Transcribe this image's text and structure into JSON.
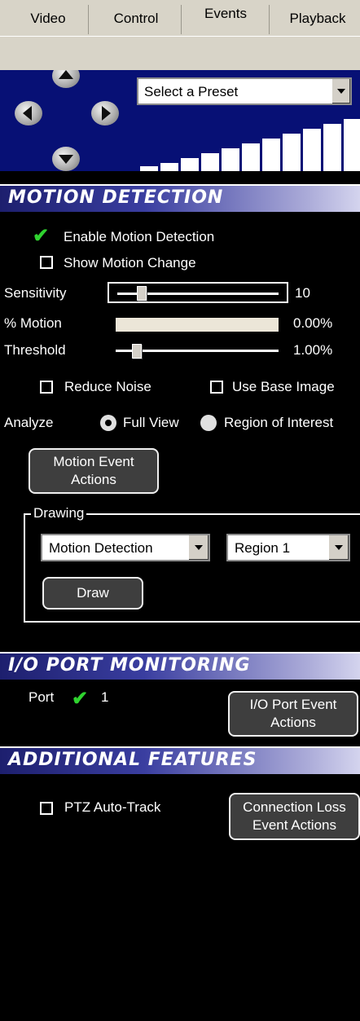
{
  "tabs": [
    {
      "label": "Video"
    },
    {
      "label": "Control"
    },
    {
      "label": "Events",
      "active": true
    },
    {
      "label": "Playback"
    }
  ],
  "ptz": {
    "preset_select": "Select a Preset"
  },
  "motion": {
    "header": "MOTION DETECTION",
    "enable_label": "Enable Motion Detection",
    "enable_checked": true,
    "show_change_label": "Show Motion Change",
    "show_change_checked": false,
    "sensitivity_label": "Sensitivity",
    "sensitivity_value": "10",
    "percent_motion_label": "% Motion",
    "percent_motion_value": "0.00%",
    "threshold_label": "Threshold",
    "threshold_value": "1.00%",
    "reduce_noise_label": "Reduce Noise",
    "base_image_label": "Use Base Image",
    "analyze_label": "Analyze",
    "analyze_options": [
      "Full View",
      "Region of Interest"
    ],
    "analyze_selected": "Full View",
    "event_actions_line1": "Motion Event",
    "event_actions_line2": "Actions",
    "drawing_legend": "Drawing",
    "drawing_mode": "Motion Detection",
    "drawing_region": "Region 1",
    "draw_button": "Draw"
  },
  "io": {
    "header": "I/O PORT MONITORING",
    "port_label": "Port",
    "port_value": "1",
    "port_checked": true,
    "event_actions_line1": "I/O Port Event",
    "event_actions_line2": "Actions"
  },
  "additional": {
    "header": "ADDITIONAL FEATURES",
    "ptz_autotrack_label": "PTZ Auto-Track",
    "connection_loss_line1": "Connection Loss",
    "connection_loss_line2": "Event Actions"
  }
}
